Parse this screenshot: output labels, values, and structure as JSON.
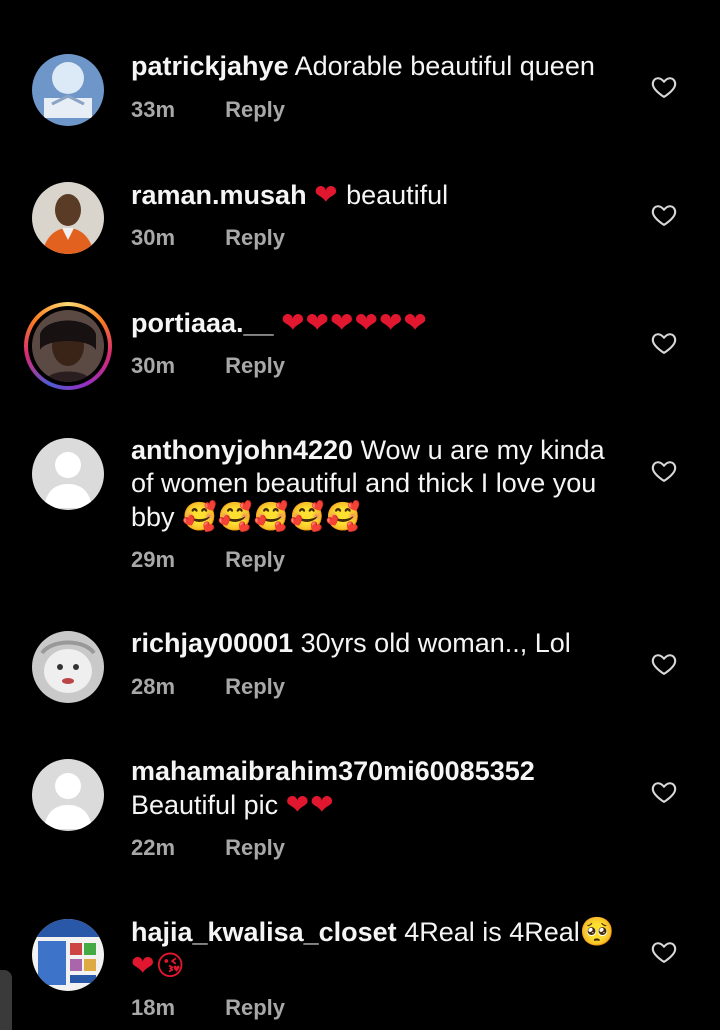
{
  "comments": [
    {
      "username": "patrickjahye",
      "text": "Adorable beautiful queen",
      "emoji": "",
      "time": "33m",
      "reply": "Reply"
    },
    {
      "username": "raman.musah",
      "text": "beautiful",
      "emoji": "❤",
      "time": "30m",
      "reply": "Reply"
    },
    {
      "username": "portiaaa.__",
      "text": "",
      "emoji": "❤❤❤❤❤❤",
      "time": "30m",
      "reply": "Reply"
    },
    {
      "username": "anthonyjohn4220",
      "text": "Wow u are my kinda of women beautiful and thick I love you bby",
      "emoji": "🥰🥰🥰🥰🥰",
      "time": "29m",
      "reply": "Reply"
    },
    {
      "username": "richjay00001",
      "text": "30yrs old woman.., Lol",
      "emoji": "",
      "time": "28m",
      "reply": "Reply"
    },
    {
      "username": "mahamaibrahim370mi60085352",
      "text": "Beautiful pic",
      "emoji": "❤❤",
      "time": "22m",
      "reply": "Reply"
    },
    {
      "username": "hajia_kwalisa_closet",
      "text": "4Real is 4Real",
      "emoji": "🥺",
      "emoji2": "❤😘",
      "time": "18m",
      "reply": "Reply"
    }
  ],
  "colors": {
    "background": "#000000",
    "heart_emoji": "#e0172e",
    "muted_text": "#a8a8a8"
  },
  "icons": {
    "like": "heart-outline-icon"
  }
}
